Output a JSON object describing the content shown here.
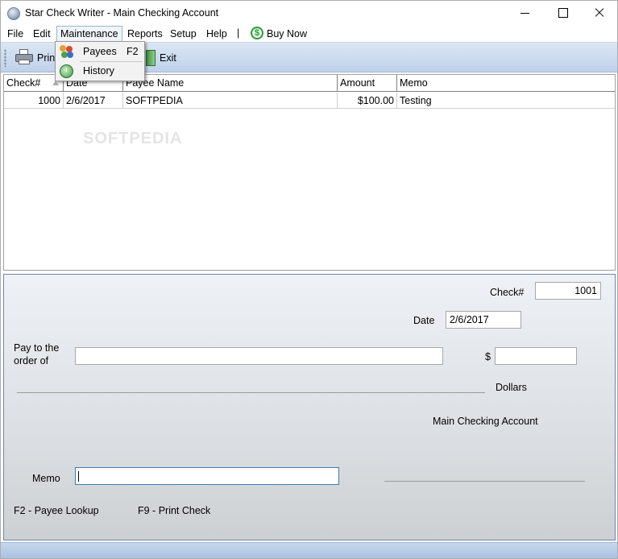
{
  "window": {
    "title": "Star Check Writer - Main Checking Account"
  },
  "menu": {
    "file": "File",
    "edit": "Edit",
    "maintenance": "Maintenance",
    "reports": "Reports",
    "setup": "Setup",
    "help": "Help",
    "separator": "|",
    "buy_now": "Buy Now",
    "buy_now_icon_glyph": "$"
  },
  "toolbar": {
    "print": "Print",
    "exit": "Exit"
  },
  "dropdown": {
    "items": [
      {
        "label": "Payees",
        "shortcut": "F2",
        "icon": "payees-icon"
      },
      {
        "label": "History",
        "shortcut": "",
        "icon": "history-icon"
      }
    ]
  },
  "grid": {
    "columns": [
      "Check#",
      "Date",
      "Payee Name",
      "Amount",
      "Memo"
    ],
    "rows": [
      {
        "check": "1000",
        "date": "2/6/2017",
        "payee": "SOFTPEDIA",
        "amount": "$100.00",
        "memo": "Testing"
      }
    ],
    "sort_column": "Check#",
    "watermark": "SOFTPEDIA"
  },
  "check": {
    "check_label": "Check#",
    "check_value": "1001",
    "date_label": "Date",
    "date_value": "2/6/2017",
    "pay_to_line1": "Pay to the",
    "pay_to_line2": "order of",
    "payee_value": "",
    "dollar_sign": "$",
    "amount_value": "",
    "dollars_label": "Dollars",
    "account_name": "Main Checking Account",
    "memo_label": "Memo",
    "memo_value": "",
    "hint_payee": "F2 - Payee Lookup",
    "hint_print": "F9 - Print Check"
  },
  "colors": {
    "toolbar_top": "#dbe6f4",
    "toolbar_bottom": "#bfd2ea",
    "check_border": "#6b87a8",
    "buy_now_green": "#2c9a3a"
  }
}
